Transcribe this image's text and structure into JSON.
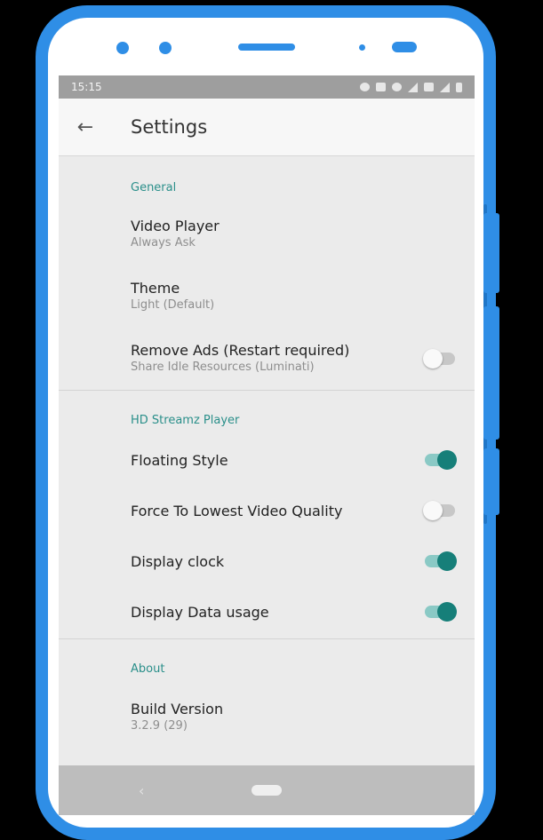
{
  "status_bar": {
    "time": "15:15",
    "icons": [
      "alarm-icon",
      "cast-icon",
      "wifi-icon",
      "signal-icon",
      "no-sim-icon",
      "signal-icon",
      "battery-icon"
    ]
  },
  "app_bar": {
    "back_icon": "←",
    "title": "Settings"
  },
  "sections": {
    "general": {
      "header": "General",
      "video_player": {
        "title": "Video Player",
        "subtitle": "Always Ask"
      },
      "theme": {
        "title": "Theme",
        "subtitle": "Light (Default)"
      },
      "remove_ads": {
        "title": "Remove Ads (Restart required)",
        "subtitle": "Share Idle Resources (Luminati)",
        "enabled": false
      }
    },
    "player": {
      "header": "HD Streamz Player",
      "floating_style": {
        "title": "Floating Style",
        "enabled": true
      },
      "lowest_quality": {
        "title": "Force To Lowest Video Quality",
        "enabled": false
      },
      "display_clock": {
        "title": "Display clock",
        "enabled": true
      },
      "data_usage": {
        "title": "Display Data usage",
        "enabled": true
      }
    },
    "about": {
      "header": "About",
      "build_version": {
        "title": "Build Version",
        "subtitle": "3.2.9 (29)"
      }
    }
  },
  "nav_bar": {
    "back_icon": "‹"
  },
  "colors": {
    "frame": "#2f8ee6",
    "accent": "#167f79",
    "track_on": "#8ac9c5",
    "section_header": "#2a8f8a"
  }
}
